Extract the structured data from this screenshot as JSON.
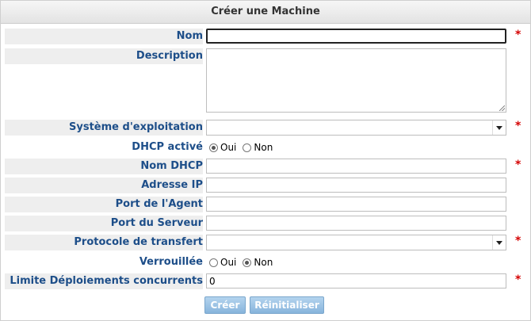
{
  "form": {
    "title": "Créer une Machine",
    "required_mark": "*",
    "fields": {
      "nom": {
        "label": "Nom",
        "value": ""
      },
      "description": {
        "label": "Description",
        "value": ""
      },
      "os": {
        "label": "Système d'exploitation",
        "selected": ""
      },
      "dhcp": {
        "label": "DHCP activé",
        "options": [
          "Oui",
          "Non"
        ],
        "selected": "Oui"
      },
      "nom_dhcp": {
        "label": "Nom DHCP",
        "value": ""
      },
      "ip": {
        "label": "Adresse IP",
        "value": ""
      },
      "port_agent": {
        "label": "Port de l'Agent",
        "value": ""
      },
      "port_serveur": {
        "label": "Port du Serveur",
        "value": ""
      },
      "protocole": {
        "label": "Protocole de transfert",
        "selected": ""
      },
      "verrouillee": {
        "label": "Verrouillée",
        "options": [
          "Oui",
          "Non"
        ],
        "selected": "Non"
      },
      "limite": {
        "label": "Limite Déploiements concurrents",
        "value": "0"
      }
    },
    "buttons": {
      "create": "Créer",
      "reset": "Réinitialiser"
    }
  },
  "colors": {
    "label": "#1d4e89",
    "required": "#d40000",
    "button": "#9ec6e8"
  }
}
